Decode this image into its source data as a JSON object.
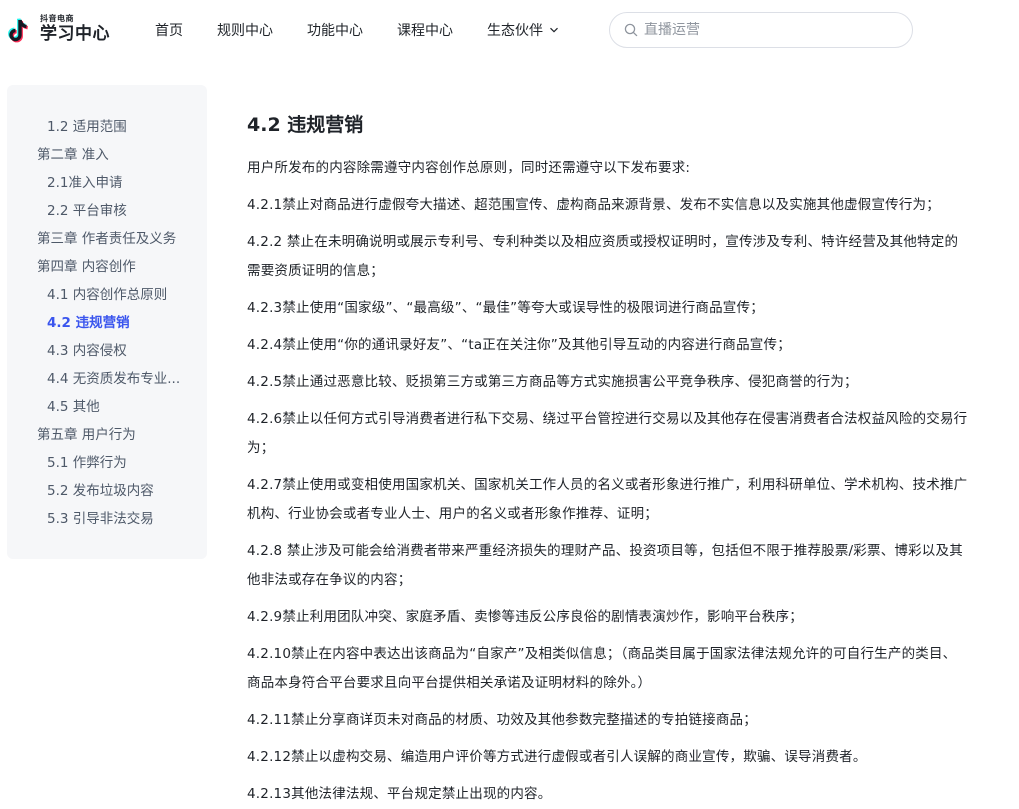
{
  "header": {
    "logo_small": "抖音电商",
    "logo_big": "学习中心",
    "nav": [
      {
        "label": "首页"
      },
      {
        "label": "规则中心"
      },
      {
        "label": "功能中心"
      },
      {
        "label": "课程中心"
      },
      {
        "label": "生态伙伴",
        "has_dropdown": true
      }
    ],
    "search": {
      "placeholder": "直播运营",
      "value": ""
    }
  },
  "sidebar": {
    "items": [
      {
        "label": "1.2 适用范围",
        "level": 2
      },
      {
        "label": "第二章 准入",
        "level": 1
      },
      {
        "label": "2.1准入申请",
        "level": 2
      },
      {
        "label": "2.2 平台审核",
        "level": 2
      },
      {
        "label": "第三章 作者责任及义务",
        "level": 1
      },
      {
        "label": "第四章 内容创作",
        "level": 1
      },
      {
        "label": "4.1 内容创作总原则",
        "level": 2
      },
      {
        "label": "4.2 违规营销",
        "level": 2,
        "active": true
      },
      {
        "label": "4.3 内容侵权",
        "level": 2
      },
      {
        "label": "4.4 无资质发布专业...",
        "level": 2
      },
      {
        "label": "4.5 其他",
        "level": 2
      },
      {
        "label": "第五章 用户行为",
        "level": 1
      },
      {
        "label": "5.1 作弊行为",
        "level": 2
      },
      {
        "label": "5.2 发布垃圾内容",
        "level": 2
      },
      {
        "label": "5.3 引导非法交易",
        "level": 2
      }
    ]
  },
  "main": {
    "heading": "4.2 违规营销",
    "paragraphs": [
      "用户所发布的内容除需遵守内容创作总原则，同时还需遵守以下发布要求:",
      "4.2.1禁止对商品进行虚假夸大描述、超范围宣传、虚构商品来源背景、发布不实信息以及实施其他虚假宣传行为；",
      "4.2.2 禁止在未明确说明或展示专利号、专利种类以及相应资质或授权证明时，宣传涉及专利、特许经营及其他特定的需要资质证明的信息；",
      "4.2.3禁止使用“国家级”、“最高级”、“最佳”等夸大或误导性的极限词进行商品宣传；",
      "4.2.4禁止使用“你的通讯录好友”、“ta正在关注你”及其他引导互动的内容进行商品宣传；",
      "4.2.5禁止通过恶意比较、贬损第三方或第三方商品等方式实施损害公平竞争秩序、侵犯商誉的行为；",
      "4.2.6禁止以任何方式引导消费者进行私下交易、绕过平台管控进行交易以及其他存在侵害消费者合法权益风险的交易行为；",
      "4.2.7禁止使用或变相使用国家机关、国家机关工作人员的名义或者形象进行推广，利用科研单位、学术机构、技术推广机构、行业协会或者专业人士、用户的名义或者形象作推荐、证明；",
      "4.2.8 禁止涉及可能会给消费者带来严重经济损失的理财产品、投资项目等，包括但不限于推荐股票/彩票、博彩以及其他非法或存在争议的内容；",
      "4.2.9禁止利用团队冲突、家庭矛盾、卖惨等违反公序良俗的剧情表演炒作，影响平台秩序；",
      "4.2.10禁止在内容中表达出该商品为“自家产”及相类似信息；（商品类目属于国家法律法规允许的可自行生产的类目、商品本身符合平台要求且向平台提供相关承诺及证明材料的除外。）",
      "4.2.11禁止分享商详页未对商品的材质、功效及其他参数完整描述的专拍链接商品；",
      "4.2.12禁止以虚构交易、编造用户评价等方式进行虚假或者引人误解的商业宣传，欺骗、误导消费者。",
      "4.2.13其他法律法规、平台规定禁止出现的内容。"
    ]
  },
  "colors": {
    "accent": "#3a55ee",
    "sidebar_bg": "#f6f7f9",
    "text": "#1f2329",
    "muted": "#4e5969"
  }
}
